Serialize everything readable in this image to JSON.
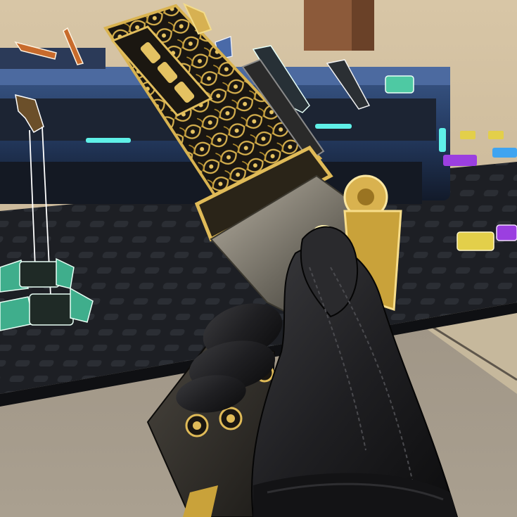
{
  "scene": {
    "view": "first-person",
    "held_item": "ornate-gold-pistol-icon",
    "world_items": [
      "weapon-pickup-icon",
      "ammo-box-icon",
      "armor-pickup-icon",
      "attachment-pickup-icon"
    ]
  },
  "colors": {
    "sand": "#c9b79a",
    "sand_shadow": "#8f8270",
    "rack_blue": "#2a3f66",
    "rack_dark": "#151a22",
    "floor_mat": "#1b1d21",
    "gold": "#c9a23a",
    "gold_bright": "#f1d27a",
    "gun_black": "#1a1815",
    "steel": "#8a857a",
    "glove": "#1c1c1e",
    "cyan_glow": "#5ff0e8",
    "teal_ammo": "#3fae8c",
    "purple_ammo": "#9b3fe0",
    "yellow_ammo": "#e3cf4a",
    "blue_ammo": "#3fa4f0"
  }
}
